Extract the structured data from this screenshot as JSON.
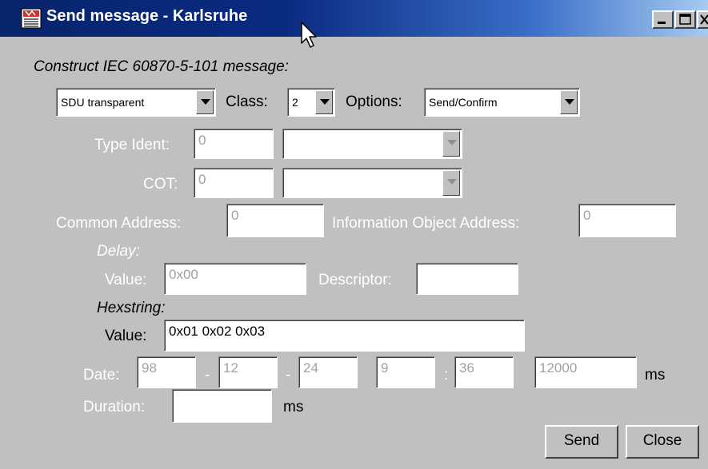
{
  "window": {
    "title": "Send message - Karlsruhe"
  },
  "heading": "Construct IEC 60870-5-101 message:",
  "row1": {
    "mode_value": "SDU transparent",
    "class_label": "Class:",
    "class_value": "2",
    "options_label": "Options:",
    "options_value": "Send/Confirm"
  },
  "type_ident": {
    "label": "Type Ident:",
    "value": "0",
    "combo_value": ""
  },
  "cot": {
    "label": "COT:",
    "value": "0",
    "combo_value": ""
  },
  "common_address": {
    "label": "Common Address:",
    "value": "0"
  },
  "ioa": {
    "label": "Information Object Address:",
    "value": "0"
  },
  "delay": {
    "heading": "Delay:",
    "value_label": "Value:",
    "value": "0x00",
    "descriptor_label": "Descriptor:",
    "descriptor_value": ""
  },
  "hexstring": {
    "heading": "Hexstring:",
    "value_label": "Value:",
    "value": "0x01 0x02 0x03"
  },
  "date": {
    "label": "Date:",
    "year": "98",
    "sep1": "-",
    "month": "12",
    "sep2": "-",
    "day": "24",
    "hour": "9",
    "sep3": ":",
    "minute": "36",
    "ms_value": "12000",
    "ms_unit": "ms"
  },
  "duration": {
    "label": "Duration:",
    "value": "",
    "unit": "ms"
  },
  "buttons": {
    "send": "Send",
    "close": "Close"
  },
  "colors": {
    "title_bar_start": "#08246b",
    "title_bar_end": "#a6caf0",
    "window_bg": "#c0c0c0",
    "disabled_text": "#ffffff"
  },
  "icons": [
    "app-icon",
    "mouse-cursor-icon",
    "minimize-icon",
    "maximize-icon",
    "close-icon"
  ]
}
